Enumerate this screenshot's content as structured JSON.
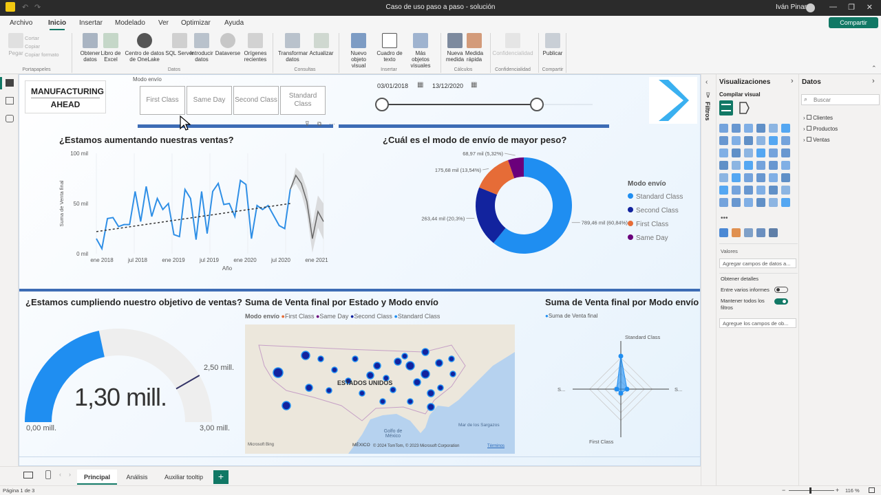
{
  "window": {
    "title": "Caso de uso paso a paso - solución",
    "user": "Iván Pinar"
  },
  "menu": [
    "Archivo",
    "Inicio",
    "Insertar",
    "Modelado",
    "Ver",
    "Optimizar",
    "Ayuda"
  ],
  "share_label": "Compartir",
  "ribbon": {
    "buttons": [
      {
        "label": "Pegar",
        "disabled": true
      },
      {
        "label": "Obtener datos",
        "disabled": false
      },
      {
        "label": "Libro de Excel",
        "disabled": false
      },
      {
        "label": "Centro de datos de OneLake",
        "disabled": false
      },
      {
        "label": "SQL Server",
        "disabled": false
      },
      {
        "label": "Introducir datos",
        "disabled": false
      },
      {
        "label": "Dataverse",
        "disabled": false
      },
      {
        "label": "Orígenes recientes",
        "disabled": false
      },
      {
        "label": "Transformar datos",
        "disabled": false
      },
      {
        "label": "Actualizar",
        "disabled": false
      },
      {
        "label": "Nuevo objeto visual",
        "disabled": false
      },
      {
        "label": "Cuadro de texto",
        "disabled": false
      },
      {
        "label": "Más objetos visuales",
        "disabled": false
      },
      {
        "label": "Nueva medida",
        "disabled": false
      },
      {
        "label": "Medida rápida",
        "disabled": false
      },
      {
        "label": "Confidencialidad",
        "disabled": true
      },
      {
        "label": "Publicar",
        "disabled": false
      }
    ],
    "clipboard_small": [
      "Cortar",
      "Copiar",
      "Copiar formato"
    ],
    "groups": [
      "Portapapeles",
      "Datos",
      "Consultas",
      "Insertar",
      "Cálculos",
      "Confidencialidad",
      "Compartir"
    ]
  },
  "report": {
    "logo": {
      "line1": "MANUFACTURING",
      "line2": "AHEAD"
    },
    "slicer": {
      "title": "Modo envío",
      "options": [
        "First Class",
        "Same Day",
        "Second Class",
        "Standard Class"
      ]
    },
    "date_slicer": {
      "start": "03/01/2018",
      "end": "13/12/2020"
    },
    "sales_chart": {
      "title": "¿Estamos aumentando nuestras ventas?",
      "ylabel": "Suma de Venta final",
      "xlabel": "Año",
      "yticks": [
        "100 mil",
        "50 mil",
        "0 mil"
      ],
      "xticks": [
        "ene 2018",
        "jul 2018",
        "ene 2019",
        "jul 2019",
        "ene 2020",
        "jul 2020",
        "ene 2021"
      ]
    },
    "donut": {
      "title": "¿Cuál es el modo de envío de mayor peso?",
      "legend_title": "Modo envío"
    },
    "gauge": {
      "title": "¿Estamos cumpliendo nuestro objetivo de ventas?",
      "value_label": "1,30 mill.",
      "min_label": "0,00 mill.",
      "max_label": "3,00 mill.",
      "target_label": "2,50 mill.",
      "value": 1.3,
      "min": 0,
      "max": 3,
      "target": 2.5
    },
    "map": {
      "title": "Suma de Venta final por Estado y Modo envío",
      "legend_title": "Modo envío",
      "legend": [
        "First Class",
        "Same Day",
        "Second Class",
        "Standard Class"
      ],
      "country": "ESTADOS UNIDOS",
      "labels": [
        "Golfo de México",
        "MÉXICO",
        "Mar de los Sargazos"
      ],
      "credit": "© 2024 TomTom, © 2023 Microsoft Corporation",
      "terms": "Términos",
      "brand": "Microsoft Bing"
    },
    "radar": {
      "title": "Suma de Venta final por Modo envío",
      "legend": "Suma de Venta final",
      "labels": [
        "Standard Class",
        "S...",
        "S...",
        "First Class"
      ]
    }
  },
  "chart_data": [
    {
      "type": "line",
      "title": "¿Estamos aumentando nuestras ventas?",
      "xlabel": "Año",
      "ylabel": "Suma de Venta final",
      "ylim": [
        0,
        100
      ],
      "x": [
        "ene 2018",
        "feb 2018",
        "mar 2018",
        "abr 2018",
        "may 2018",
        "jun 2018",
        "jul 2018",
        "ago 2018",
        "sep 2018",
        "oct 2018",
        "nov 2018",
        "dic 2018",
        "ene 2019",
        "feb 2019",
        "mar 2019",
        "abr 2019",
        "may 2019",
        "jun 2019",
        "jul 2019",
        "ago 2019",
        "sep 2019",
        "oct 2019",
        "nov 2019",
        "dic 2019",
        "ene 2020",
        "feb 2020",
        "mar 2020",
        "abr 2020",
        "may 2020",
        "jun 2020",
        "jul 2020",
        "ago 2020",
        "sep 2020",
        "oct 2020",
        "nov 2020",
        "dic 2020"
      ],
      "series": [
        {
          "name": "Suma de Venta final",
          "values": [
            15,
            5,
            35,
            36,
            27,
            29,
            29,
            62,
            32,
            67,
            37,
            55,
            44,
            50,
            19,
            17,
            64,
            55,
            14,
            62,
            20,
            62,
            70,
            49,
            50,
            37,
            73,
            69,
            15,
            48,
            44,
            48,
            38,
            28,
            25,
            64
          ]
        }
      ],
      "forecast": {
        "x": [
          "ene 2021",
          "feb 2021",
          "mar 2021",
          "abr 2021",
          "may 2021",
          "jun 2021"
        ],
        "values": [
          78,
          70,
          52,
          15,
          42,
          32
        ]
      },
      "trendline": {
        "start": 22,
        "end": 50
      }
    },
    {
      "type": "pie",
      "title": "¿Cuál es el modo de envío de mayor peso?",
      "labels": [
        "Standard Class",
        "Second Class",
        "First Class",
        "Same Day"
      ],
      "values": [
        789.46,
        263.44,
        175.68,
        68.97
      ],
      "value_labels": [
        "789,46 mil (60,84%)",
        "263,44 mil (20,3%)",
        "175,68 mil (13,54%)",
        "68,97 mil (5,32%)"
      ],
      "colors": [
        "#1f8ef1",
        "#12239e",
        "#e66c37",
        "#6b007b"
      ],
      "legend": "right"
    },
    {
      "type": "radar",
      "title": "Suma de Venta final por Modo envío",
      "labels": [
        "Standard Class",
        "S...",
        "First Class",
        "S..."
      ],
      "values": [
        0.8,
        0.15,
        0.1,
        0.1
      ]
    }
  ],
  "panes": {
    "filters_label": "Filtros",
    "viz": {
      "title": "Visualizaciones",
      "build": "Compilar visual",
      "values_label": "Valores",
      "values_placeholder": "Agregar campos de datos a...",
      "drill_label": "Obtener detalles",
      "cross_report": "Entre varios informes",
      "keep_filters": "Mantener todos los filtros",
      "drill_placeholder": "Agregue los campos de ob..."
    },
    "data": {
      "title": "Datos",
      "search_placeholder": "Buscar",
      "tables": [
        "Clientes",
        "Productos",
        "Ventas"
      ]
    }
  },
  "tabs": [
    "Principal",
    "Análisis",
    "Auxiliar tooltip"
  ],
  "status": {
    "page": "Página 1 de 3",
    "zoom": "116 %"
  },
  "colors": {
    "accent": "#117865",
    "brand_blue": "#118dff",
    "standard": "#1f8ef1",
    "second": "#12239e",
    "first": "#e66c37",
    "sameday": "#6b007b"
  }
}
